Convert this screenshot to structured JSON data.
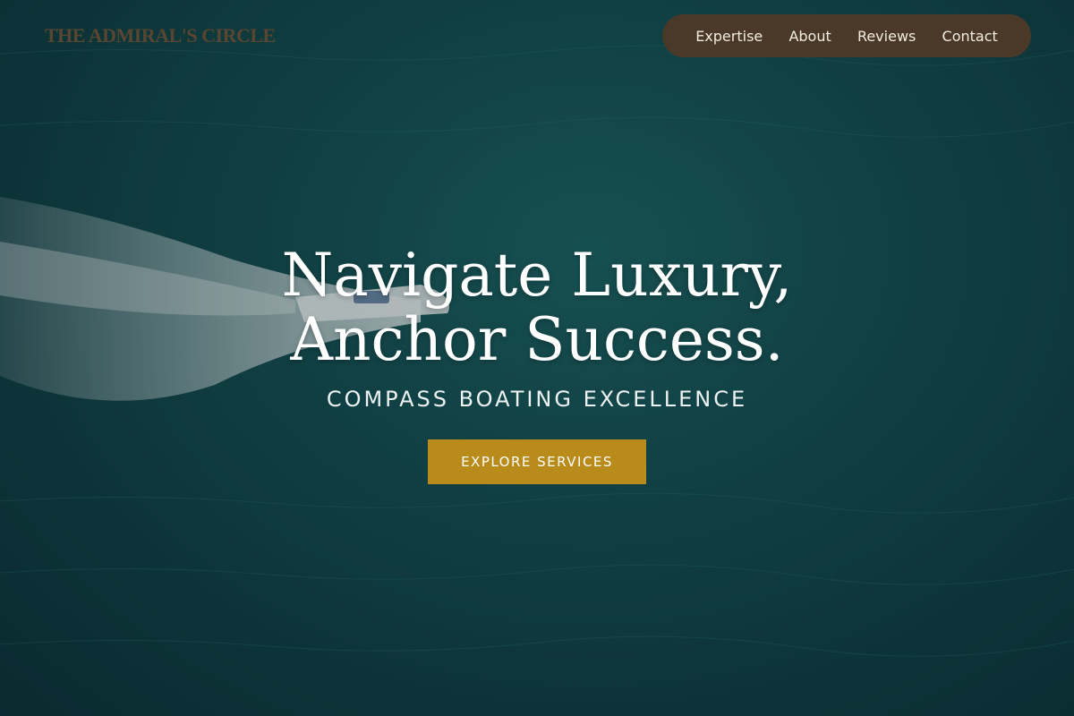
{
  "brand": {
    "logo_text": "THE ADMIRAL'S CIRCLE"
  },
  "nav": {
    "items": [
      {
        "label": "Expertise"
      },
      {
        "label": "About"
      },
      {
        "label": "Reviews"
      },
      {
        "label": "Contact"
      }
    ]
  },
  "hero": {
    "headline_line1": "Navigate Luxury,",
    "headline_line2": "Anchor Success.",
    "subtitle": "COMPASS BOATING EXCELLENCE",
    "cta_label": "EXPLORE SERVICES",
    "background_image": "aerial ocean with speedboat wake"
  },
  "colors": {
    "logo": "#5a4630",
    "nav_pill": "#4a3928",
    "cta": "#b88b1b",
    "sea": "#154f52"
  }
}
